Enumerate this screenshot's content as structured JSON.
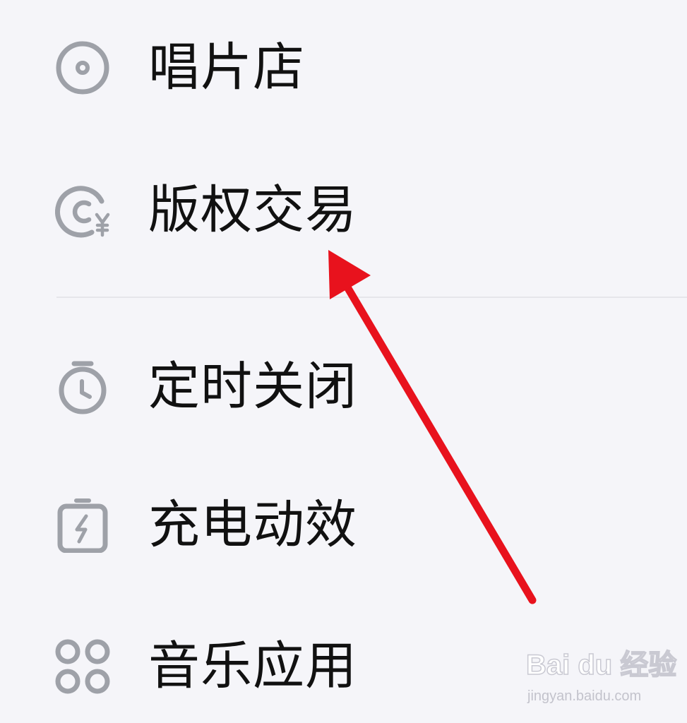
{
  "menu": {
    "items": [
      {
        "label": "唱片店",
        "icon": "disc-icon"
      },
      {
        "label": "版权交易",
        "icon": "copyright-yen-icon"
      },
      {
        "label": "定时关闭",
        "icon": "timer-icon"
      },
      {
        "label": "充电动效",
        "icon": "battery-charging-icon"
      },
      {
        "label": "音乐应用",
        "icon": "apps-grid-icon"
      }
    ]
  },
  "annotation": {
    "arrow_color": "#e8121d",
    "points_to": "版权交易"
  },
  "watermark": {
    "brand": "Bai du 经验",
    "url": "jingyan.baidu.com"
  },
  "colors": {
    "background": "#f5f5f9",
    "icon": "#9ea1a8",
    "text": "#111111",
    "divider": "#e6e6eb"
  }
}
